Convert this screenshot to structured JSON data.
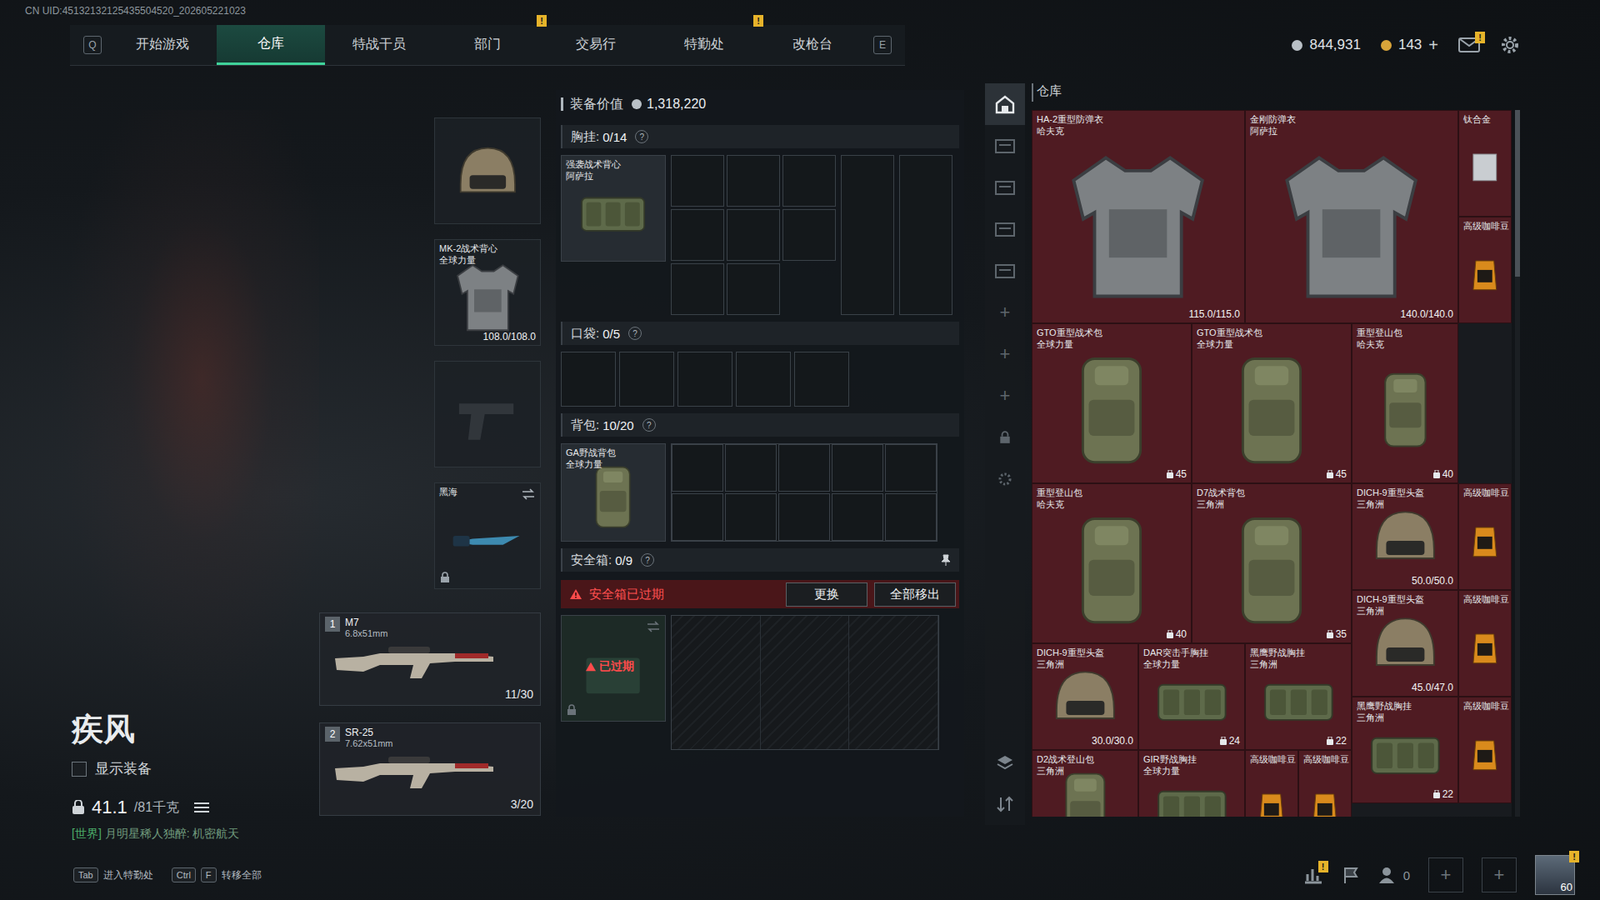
{
  "uid": "CN UID:45132132125435504520_202605221023",
  "nav": {
    "left_key": "Q",
    "right_key": "E",
    "tabs": [
      {
        "label": "开始游戏",
        "selected": false,
        "badge": ""
      },
      {
        "label": "仓库",
        "selected": true,
        "badge": ""
      },
      {
        "label": "特战干员",
        "selected": false,
        "badge": ""
      },
      {
        "label": "部门",
        "selected": false,
        "badge": "!"
      },
      {
        "label": "交易行",
        "selected": false,
        "badge": ""
      },
      {
        "label": "特勤处",
        "selected": false,
        "badge": "!"
      },
      {
        "label": "改枪台",
        "selected": false,
        "badge": ""
      }
    ]
  },
  "currencies": [
    {
      "kind": "coin",
      "amount": "844,931",
      "add": ""
    },
    {
      "kind": "gold",
      "amount": "143",
      "add": "+"
    }
  ],
  "mail": {
    "badge": "!"
  },
  "character": {
    "name": "疾风",
    "show_gear": {
      "label": "显示装备",
      "checked": false
    },
    "weight": "41.1",
    "weight_max": "/81千克",
    "chat": {
      "channel": "[世界]",
      "text": "月明星稀人独醉: 机密航天"
    }
  },
  "gear_slots": [
    {
      "kind": "helmet",
      "name": "",
      "sub": "",
      "durability": "",
      "locked": false,
      "swap": false
    },
    {
      "kind": "armor",
      "name": "MK-2战术背心",
      "sub": "全球力量",
      "durability": "108.0/108.0",
      "locked": false,
      "swap": false
    },
    {
      "kind": "pistol",
      "name": "",
      "sub": "",
      "durability": "",
      "locked": false,
      "swap": false
    },
    {
      "kind": "melee",
      "name": "黑海",
      "sub": "",
      "durability": "",
      "locked": true,
      "swap": true
    }
  ],
  "weapons": [
    {
      "slot": "1",
      "name": "M7",
      "caliber": "6.8x51mm",
      "ammo": "11/30"
    },
    {
      "slot": "2",
      "name": "SR-25",
      "caliber": "7.62x51mm",
      "ammo": "3/20"
    }
  ],
  "loadout": {
    "value_label": "装备价值",
    "value": "1,318,220",
    "rig": {
      "label": "胸挂:",
      "count": "0/14",
      "help": "?",
      "item": {
        "name": "强袭战术背心",
        "sub": "阿萨拉"
      }
    },
    "pockets": {
      "label": "口袋:",
      "count": "0/5",
      "help": "?"
    },
    "backpack": {
      "label": "背包:",
      "count": "10/20",
      "help": "?",
      "item": {
        "name": "GA野战背包",
        "sub": "全球力量"
      }
    },
    "safe": {
      "label": "安全箱:",
      "count": "0/9",
      "help": "?",
      "expired": true,
      "warning": "安全箱已过期",
      "buttons": [
        "更换",
        "全部移出"
      ],
      "item_status": "已过期"
    }
  },
  "warehouse": {
    "title": "仓库",
    "sidebar": [
      {
        "kind": "home",
        "glyph": "",
        "selected": true
      },
      {
        "kind": "tab",
        "glyph": "",
        "selected": false
      },
      {
        "kind": "tab",
        "glyph": "",
        "selected": false
      },
      {
        "kind": "tab",
        "glyph": "",
        "selected": false
      },
      {
        "kind": "tab",
        "glyph": "",
        "selected": false
      },
      {
        "kind": "add",
        "glyph": "+",
        "selected": false
      },
      {
        "kind": "add",
        "glyph": "+",
        "selected": false
      },
      {
        "kind": "add",
        "glyph": "+",
        "selected": false
      },
      {
        "kind": "lock",
        "glyph": "",
        "selected": false
      },
      {
        "kind": "settings",
        "glyph": "",
        "selected": false
      }
    ],
    "sidebar_bottom": [
      {
        "kind": "layers"
      },
      {
        "kind": "sort"
      }
    ],
    "items": [
      {
        "kind": "armor",
        "name": "HA-2重型防弹衣",
        "sub": "哈夫克",
        "durability": "115.0/115.0",
        "capacity": ""
      },
      {
        "kind": "armor",
        "name": "金刚防弹衣",
        "sub": "阿萨拉",
        "durability": "140.0/140.0",
        "capacity": ""
      },
      {
        "kind": "ingot",
        "name": "钛合金",
        "sub": "",
        "durability": "",
        "capacity": ""
      },
      {
        "kind": "coffee",
        "name": "高级咖啡豆",
        "sub": "",
        "durability": "",
        "capacity": ""
      },
      {
        "kind": "pack-large",
        "name": "GTO重型战术包",
        "sub": "全球力量",
        "durability": "",
        "capacity": "45"
      },
      {
        "kind": "pack-large",
        "name": "GTO重型战术包",
        "sub": "全球力量",
        "durability": "",
        "capacity": "45"
      },
      {
        "kind": "pack",
        "name": "重型登山包",
        "sub": "哈夫克",
        "durability": "",
        "capacity": "40"
      },
      {
        "kind": "pack-large",
        "name": "重型登山包",
        "sub": "哈夫克",
        "durability": "",
        "capacity": "40"
      },
      {
        "kind": "pack-large",
        "name": "D7战术背包",
        "sub": "三角洲",
        "durability": "",
        "capacity": "35"
      },
      {
        "kind": "helmet",
        "name": "DICH-9重型头盔",
        "sub": "三角洲",
        "durability": "50.0/50.0",
        "capacity": ""
      },
      {
        "kind": "coffee",
        "name": "高级咖啡豆",
        "sub": "",
        "durability": "",
        "capacity": ""
      },
      {
        "kind": "helmet",
        "name": "DICH-9重型头盔",
        "sub": "三角洲",
        "durability": "45.0/47.0",
        "capacity": ""
      },
      {
        "kind": "coffee",
        "name": "高级咖啡豆",
        "sub": "",
        "durability": "",
        "capacity": ""
      },
      {
        "kind": "helmet",
        "name": "DICH-9重型头盔",
        "sub": "三角洲",
        "durability": "30.0/30.0",
        "capacity": ""
      },
      {
        "kind": "rig",
        "name": "DAR突击手胸挂",
        "sub": "全球力量",
        "durability": "",
        "capacity": "24"
      },
      {
        "kind": "rig",
        "name": "黑鹰野战胸挂",
        "sub": "三角洲",
        "durability": "",
        "capacity": "22"
      },
      {
        "kind": "rig",
        "name": "黑鹰野战胸挂",
        "sub": "三角洲",
        "durability": "",
        "capacity": "22"
      },
      {
        "kind": "coffee",
        "name": "高级咖啡豆",
        "sub": "",
        "durability": "",
        "capacity": ""
      },
      {
        "kind": "pack-small",
        "name": "D2战术登山包",
        "sub": "三角洲",
        "durability": "",
        "capacity": ""
      },
      {
        "kind": "rig",
        "name": "GIR野战胸挂",
        "sub": "全球力量",
        "durability": "",
        "capacity": ""
      },
      {
        "kind": "coffee",
        "name": "高级咖啡豆",
        "sub": "",
        "durability": "",
        "capacity": ""
      },
      {
        "kind": "coffee",
        "name": "高级咖啡豆",
        "sub": "",
        "durability": "",
        "capacity": ""
      }
    ]
  },
  "hotkeys": [
    {
      "keys": [
        "Tab"
      ],
      "label": "进入特勤处"
    },
    {
      "keys": [
        "Ctrl",
        "F"
      ],
      "label": "转移全部"
    }
  ],
  "footer": {
    "stats_badge": "!",
    "friends": "0",
    "add_slots": [
      "+",
      "+"
    ],
    "level": "60",
    "avatar_badge": "!"
  }
}
